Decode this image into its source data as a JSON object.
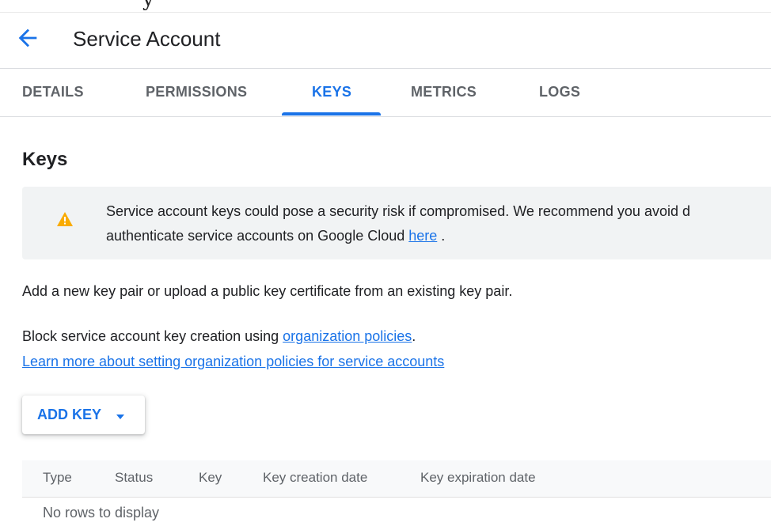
{
  "top_strip": {
    "text": "y"
  },
  "header": {
    "title": "Service Account"
  },
  "tabs": [
    {
      "label": "DETAILS",
      "active": false
    },
    {
      "label": "PERMISSIONS",
      "active": false
    },
    {
      "label": "KEYS",
      "active": true
    },
    {
      "label": "METRICS",
      "active": false
    },
    {
      "label": "LOGS",
      "active": false
    }
  ],
  "section": {
    "title": "Keys"
  },
  "warning": {
    "line1": "Service account keys could pose a security risk if compromised. We recommend you avoid d",
    "line2_prefix": "authenticate service accounts on Google Cloud ",
    "line2_link": "here",
    "line2_suffix": " ."
  },
  "info": {
    "add_key_text": "Add a new key pair or upload a public key certificate from an existing key pair.",
    "block_prefix": "Block service account key creation using ",
    "block_link": "organization policies",
    "block_suffix": ".",
    "learn_more_link": "Learn more about setting organization policies for service accounts"
  },
  "add_key_button": {
    "label": "ADD KEY"
  },
  "table": {
    "columns": [
      "Type",
      "Status",
      "Key",
      "Key creation date",
      "Key expiration date"
    ],
    "empty_text": "No rows to display"
  },
  "colors": {
    "accent": "#1a73e8",
    "warning": "#f9ab00",
    "muted_text": "#5f6368",
    "banner_bg": "#f1f3f4"
  },
  "icons": {
    "back": "arrow-back-icon",
    "warning": "warning-triangle-icon",
    "dropdown": "caret-down-icon"
  }
}
